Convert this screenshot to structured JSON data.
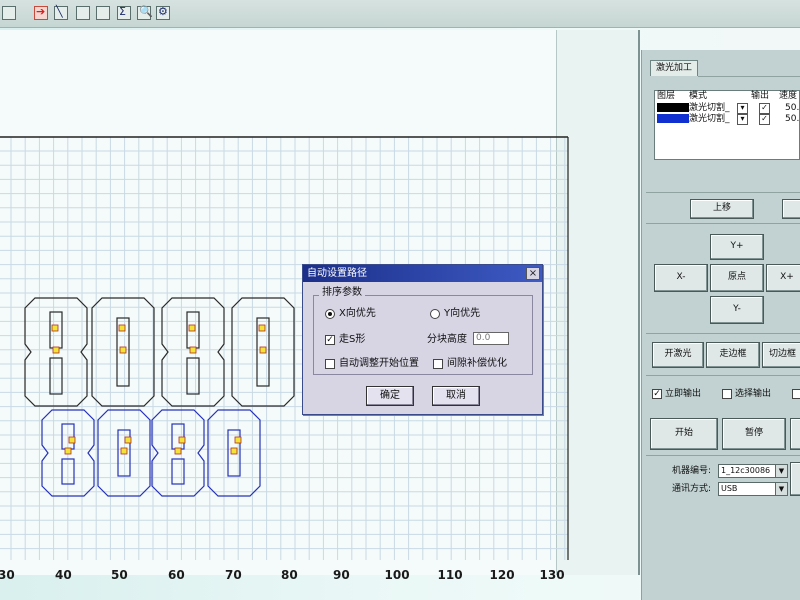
{
  "toolbar": {
    "icons": [
      "select-tool-icon",
      "arrow-tool-icon",
      "pen-tool-icon",
      "import-icon",
      "export-icon",
      "font-icon",
      "preview-icon",
      "settings-icon"
    ]
  },
  "canvas": {
    "ruler_labels": [
      "30",
      "40",
      "50",
      "60",
      "70",
      "80",
      "90",
      "100",
      "110",
      "120",
      "130"
    ],
    "digit_rows": [
      {
        "text": "8080",
        "color": "#2a2a2a"
      },
      {
        "text": "8080",
        "color": "#2733b8"
      }
    ]
  },
  "dialog": {
    "title": "自动设置路径",
    "close_label": "×",
    "group_label": "排序参数",
    "x_priority": "X向优先",
    "y_priority": "Y向优先",
    "s_shape": "走S形",
    "block_height_label": "分块高度",
    "block_height_value": "0.0",
    "auto_start": "自动调整开始位置",
    "gap_comp": "间隙补偿优化",
    "ok": "确定",
    "cancel": "取消"
  },
  "panel": {
    "tab": "激光加工",
    "headers": {
      "layer": "图层",
      "mode": "模式",
      "output": "输出",
      "speed": "速度"
    },
    "layers": [
      {
        "color": "#000000",
        "mode": "激光切割_",
        "speed": "50."
      },
      {
        "color": "#1030d0",
        "mode": "激光切割_",
        "speed": "50."
      }
    ],
    "move_up": "上移",
    "y_plus": "Y+",
    "x_minus": "X-",
    "origin": "原点",
    "x_plus": "X+",
    "y_minus": "Y-",
    "laser_on": "开激光",
    "walk_border": "走边框",
    "cut_border": "切边框",
    "instant_output": "立即输出",
    "select_output": "选择输出",
    "start": "开始",
    "pause": "暂停",
    "machine_no_label": "机器编号:",
    "machine_no": "1_12c30086",
    "comm_label": "通讯方式:",
    "comm": "USB"
  }
}
